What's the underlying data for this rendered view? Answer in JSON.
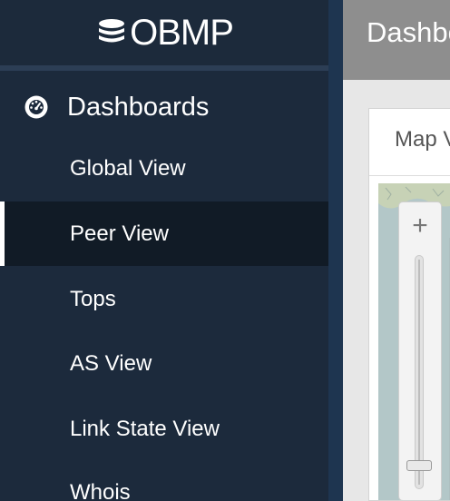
{
  "brand": {
    "name": "OBMP"
  },
  "sidebar": {
    "section": {
      "label": "Dashboards",
      "icon": "dashboard-gauge-icon"
    },
    "items": [
      {
        "label": "Global View",
        "active": false
      },
      {
        "label": "Peer View",
        "active": true
      },
      {
        "label": "Tops",
        "active": false
      },
      {
        "label": "AS View",
        "active": false
      },
      {
        "label": "Link State View",
        "active": false
      },
      {
        "label": "Whois",
        "active": false
      }
    ]
  },
  "header": {
    "title": "Dashboard"
  },
  "panel": {
    "tab_label": "Map View"
  },
  "map": {
    "zoom_in_label": "+",
    "zoom_level": 0.08
  },
  "colors": {
    "sidebar_bg": "#1c2a3c",
    "active_item_bg": "#111b26",
    "topbar_bg": "#8e8e8e",
    "content_bg": "#e7e7e7"
  }
}
